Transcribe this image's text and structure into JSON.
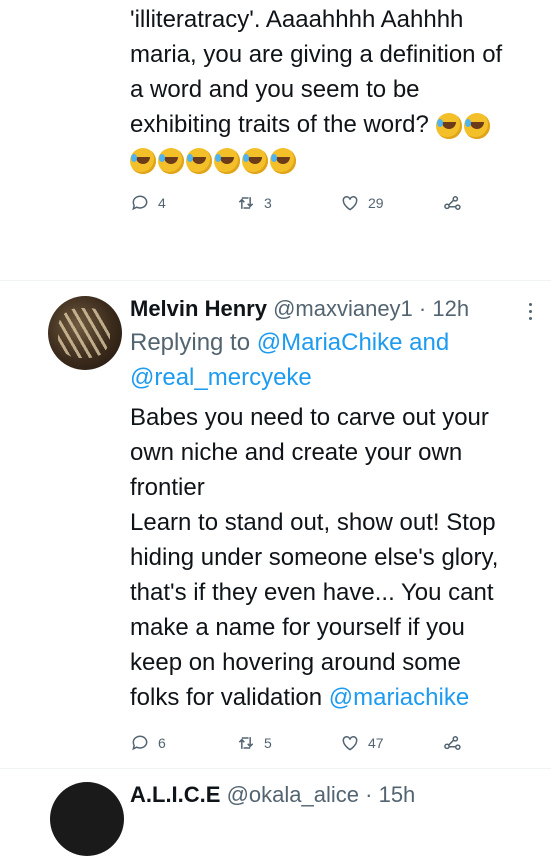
{
  "tweet1": {
    "text_lines": [
      "'illiteratracy'. Aaaahhhh Aahhhh",
      "maria, you are giving a definition of",
      "a word and you seem to be",
      "exhibiting traits of the word?"
    ],
    "emoji_name": "rolling-on-floor-laughing-emoji",
    "replies": "4",
    "retweets": "3",
    "likes": "29"
  },
  "tweet2": {
    "author_name": "Melvin Henry",
    "handle": "@maxvianey1",
    "separator": "·",
    "time": "12h",
    "replying_label": "Replying to",
    "replying_user1": "@MariaChike",
    "replying_and": "and",
    "replying_user2": "@real_mercyeke",
    "text_lines": [
      "Babes you need to carve out your",
      "own niche and create your own",
      "frontier",
      "Learn to stand out, show out! Stop",
      "hiding under someone else's glory,",
      "that's if  they even have... You cant",
      "make a name for yourself if you",
      "keep on hovering around some"
    ],
    "last_line_text": "folks for validation",
    "mention": "@mariachike",
    "replies": "6",
    "retweets": "5",
    "likes": "47"
  },
  "tweet3": {
    "author_name": "A.L.I.C.E",
    "handle": "@okala_alice",
    "separator": "·",
    "time": "15h"
  },
  "icons": [
    "reply-icon",
    "retweet-icon",
    "like-icon",
    "share-icon",
    "more-options-icon"
  ],
  "colors": {
    "link": "#1d9bf0",
    "muted": "#536471",
    "text": "#0f1419"
  }
}
